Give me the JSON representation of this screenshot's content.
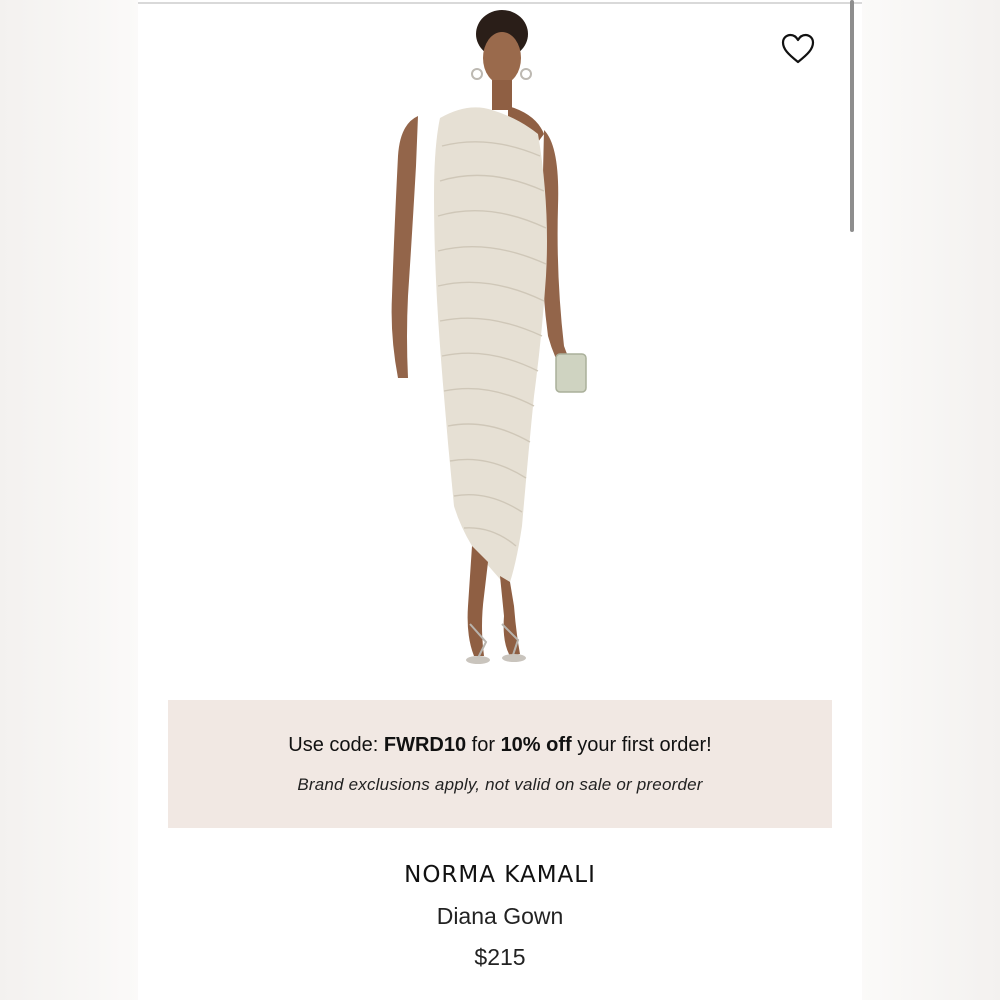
{
  "promo": {
    "prefix": "Use code: ",
    "code": "FWRD10",
    "middle": " for ",
    "discount": "10% off",
    "suffix": " your first order!",
    "disclaimer": "Brand exclusions apply, not valid on sale or preorder",
    "background": "#f1e8e3"
  },
  "product": {
    "brand": "NORMA KAMALI",
    "name": "Diana Gown",
    "price": "$215",
    "image_icon": "product-photo",
    "dress_color": "#e6e0d4"
  },
  "wishlist": {
    "icon": "heart-outline-icon"
  }
}
